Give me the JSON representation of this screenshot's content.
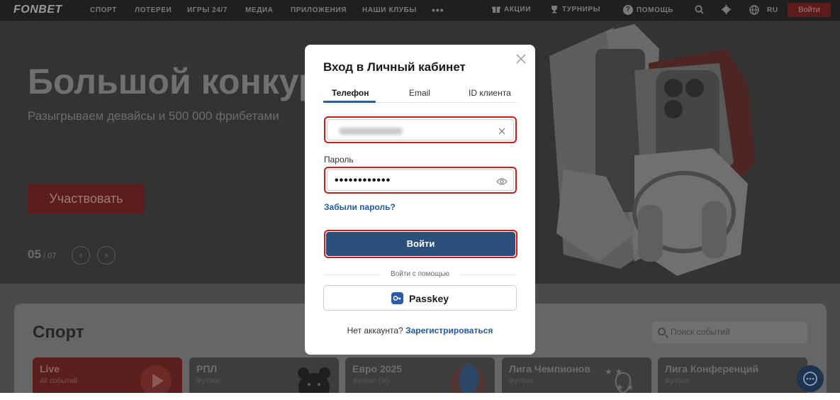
{
  "header": {
    "logo": "FONBET",
    "nav": [
      "СПОРТ",
      "ЛОТЕРЕИ",
      "ИГРЫ 24/7",
      "МЕДИА",
      "ПРИЛОЖЕНИЯ",
      "НАШИ КЛУБЫ"
    ],
    "more": "•••",
    "promos_label": "АКЦИИ",
    "tournaments_label": "ТУРНИРЫ",
    "help_label": "ПОМОЩЬ",
    "language": "RU",
    "login_label": "Войти"
  },
  "hero": {
    "title": "Большой конкур",
    "subtitle": "Разыгрываем девайсы и 500 000 фрибетами",
    "cta": "Участвовать",
    "slide_current": "05",
    "slide_total": " / 07"
  },
  "sport": {
    "title": "Спорт",
    "search_placeholder": "Поиск событий",
    "tiles": [
      {
        "title": "Live",
        "sub": "48 событий"
      },
      {
        "title": "РПЛ",
        "sub": "Футбол"
      },
      {
        "title": "Евро 2025",
        "sub": "Футбол (Ж)"
      },
      {
        "title": "Лига Чемпионов",
        "sub": "Футбол"
      },
      {
        "title": "Лига Конференций",
        "sub": "Футбол"
      }
    ]
  },
  "modal": {
    "title": "Вход в Личный кабинет",
    "tabs": [
      "Телефон",
      "Email",
      "ID клиента"
    ],
    "active_tab": "Телефон",
    "password_label": "Пароль",
    "password_value": "••••••••••••",
    "forgot_link": "Забыли пароль?",
    "submit_label": "Войти",
    "divider_text": "Войти с помощью",
    "passkey_label": "Passkey",
    "no_account_text": "Нет аккаунта?",
    "register_link": "Зарегистрироваться"
  },
  "colors": {
    "brand_red": "#d01b1b",
    "primary_blue": "#2c4f7b",
    "link_blue": "#1f5aa8",
    "overlay": "#333333"
  }
}
